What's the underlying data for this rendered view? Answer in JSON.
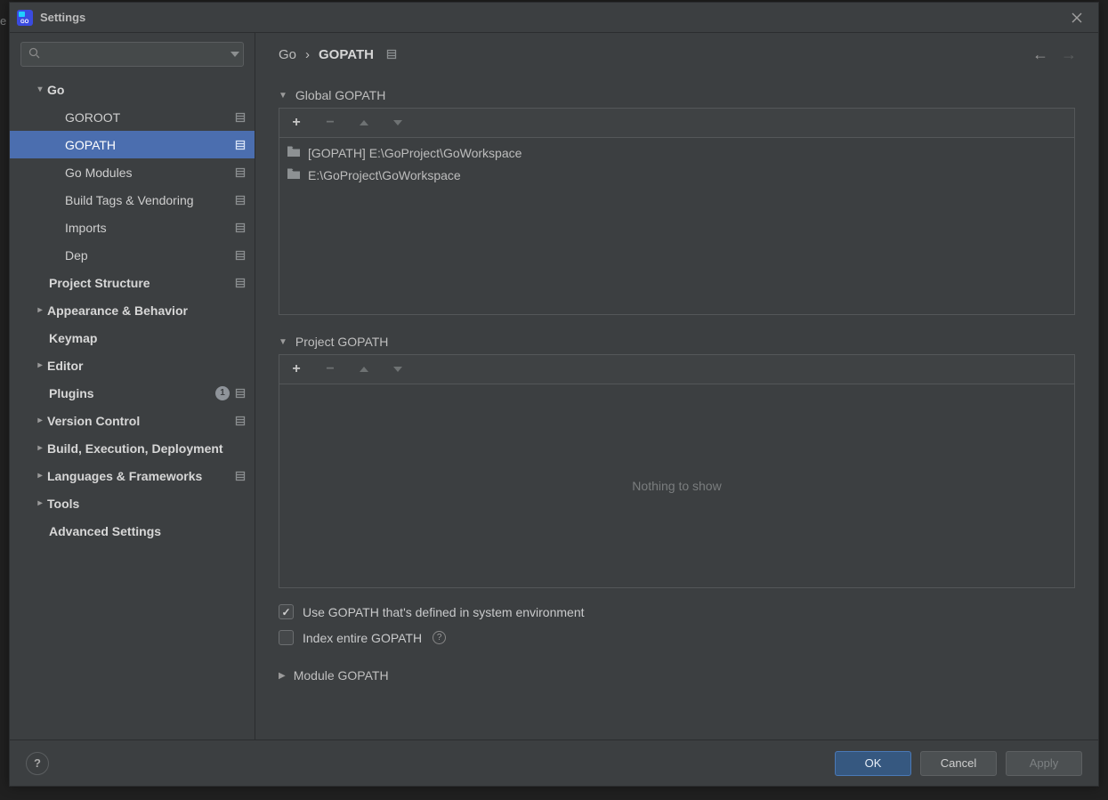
{
  "title": "Settings",
  "search": {
    "placeholder": ""
  },
  "tree": {
    "go": "Go",
    "goroot": "GOROOT",
    "gopath": "GOPATH",
    "go_modules": "Go Modules",
    "build_tags": "Build Tags & Vendoring",
    "imports": "Imports",
    "dep": "Dep",
    "project_structure": "Project Structure",
    "appearance": "Appearance & Behavior",
    "keymap": "Keymap",
    "editor": "Editor",
    "plugins": "Plugins",
    "plugins_badge": "1",
    "version_control": "Version Control",
    "build_exec": "Build, Execution, Deployment",
    "languages": "Languages & Frameworks",
    "tools": "Tools",
    "advanced": "Advanced Settings"
  },
  "breadcrumb": {
    "parent": "Go",
    "current": "GOPATH"
  },
  "sections": {
    "global": {
      "title": "Global GOPATH",
      "items": [
        "[GOPATH] E:\\GoProject\\GoWorkspace",
        "E:\\GoProject\\GoWorkspace"
      ]
    },
    "project": {
      "title": "Project GOPATH",
      "empty": "Nothing to show"
    },
    "module": {
      "title": "Module GOPATH"
    }
  },
  "options": {
    "use_system_gopath": "Use GOPATH that's defined in system environment",
    "index_entire_gopath": "Index entire GOPATH"
  },
  "footer": {
    "ok": "OK",
    "cancel": "Cancel",
    "apply": "Apply"
  }
}
